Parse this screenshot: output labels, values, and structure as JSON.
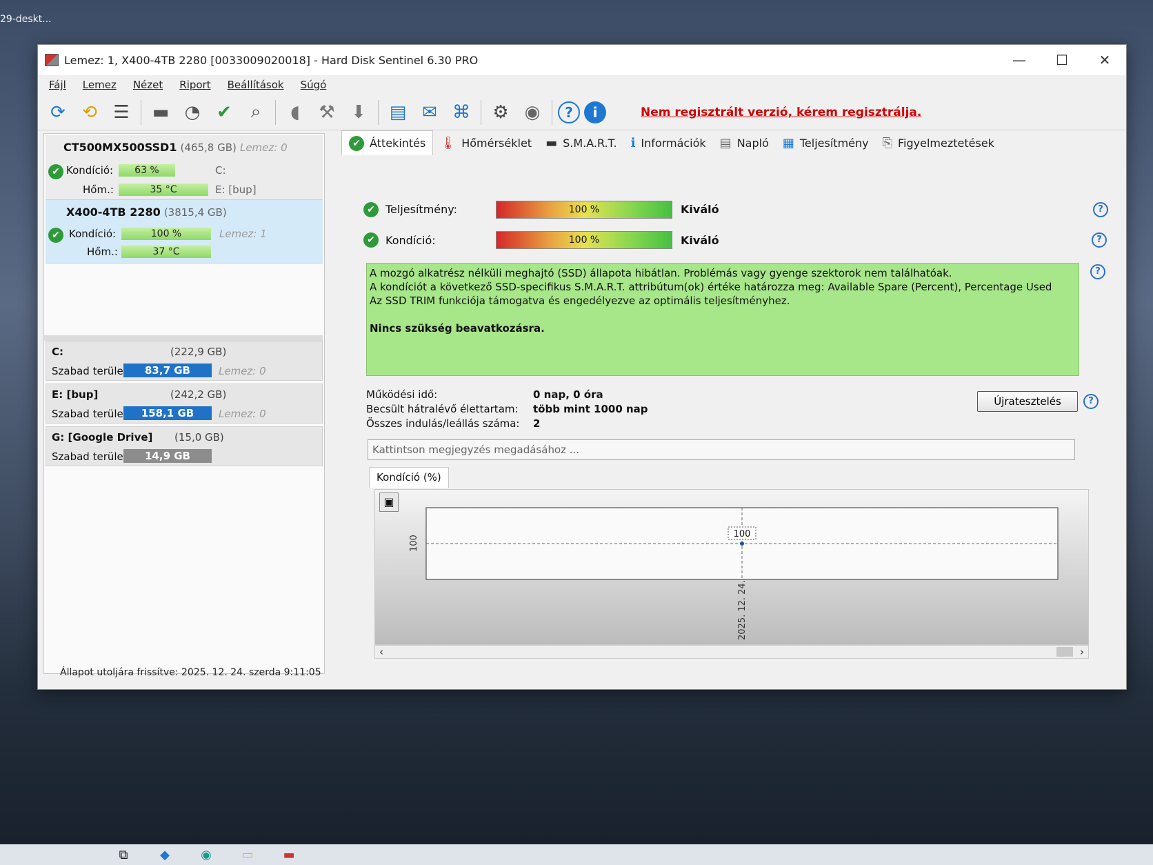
{
  "desktop": {
    "label": "29-deskt..."
  },
  "window": {
    "title": "Lemez: 1, X400-4TB 2280 [0033009020018]  -  Hard Disk Sentinel 6.30 PRO"
  },
  "controls": {
    "min": "—",
    "max": "☐",
    "close": "✕"
  },
  "menu": [
    "Fájl",
    "Lemez",
    "Nézet",
    "Riport",
    "Beállítások",
    "Súgó"
  ],
  "toolbar": {
    "icons": [
      "refresh-icon",
      "refresh-alert-icon",
      "disk-list-icon",
      "disk-icon",
      "disk-clock-icon",
      "disk-check-icon",
      "disk-search-icon",
      "helmet-icon",
      "disk-tools-icon",
      "disk-write-icon",
      "report-icon",
      "mail-icon",
      "network-icon",
      "settings-icon",
      "sound-icon",
      "help-icon",
      "info-icon"
    ],
    "glyphs": [
      "⟳",
      "⟲",
      "☰",
      "▬",
      "◔",
      "✔",
      "⌕",
      "◖",
      "⚒",
      "⬇",
      "▤",
      "✉",
      "⌘",
      "⚙",
      "◉",
      "?",
      "i"
    ],
    "registration": "Nem regisztrált verzió, kérem regisztrálja."
  },
  "disks": [
    {
      "name": "CT500MX500SSD1",
      "size": "(465,8 GB)",
      "lemez": "Lemez: 0",
      "condition_label": "Kondíció:",
      "condition": "63 %",
      "condition_value": 0.63,
      "temp_label": "Hőm.:",
      "temp": "35 °C",
      "vol1": "C:",
      "vol2": "E: [bup]"
    },
    {
      "name": "X400-4TB 2280",
      "size": "(3815,4 GB)",
      "lemez": "Lemez: 1",
      "condition_label": "Kondíció:",
      "condition": "100 %",
      "condition_value": 1.0,
      "temp_label": "Hőm.:",
      "temp": "37 °C"
    }
  ],
  "volumes": [
    {
      "name": "C:",
      "size": "(222,9 GB)",
      "free_label": "Szabad terület",
      "free": "83,7 GB",
      "lemez": "Lemez: 0"
    },
    {
      "name": "E: [bup]",
      "size": "(242,2 GB)",
      "free_label": "Szabad terület",
      "free": "158,1 GB",
      "lemez": "Lemez: 0"
    },
    {
      "name": "G: [Google Drive]",
      "size": "(15,0 GB)",
      "free_label": "Szabad terület",
      "free": "14,9 GB",
      "lemez": ""
    }
  ],
  "status": "Állapot utoljára frissítve: 2025. 12. 24. szerda 9:11:05",
  "tabs": [
    {
      "label": "Áttekintés",
      "icon": "check-icon",
      "glyph": "✔"
    },
    {
      "label": "Hőmérséklet",
      "icon": "thermometer-icon",
      "glyph": "🌡"
    },
    {
      "label": "S.M.A.R.T.",
      "icon": "smart-icon",
      "glyph": "▬"
    },
    {
      "label": "Információk",
      "icon": "info-icon",
      "glyph": "ℹ"
    },
    {
      "label": "Napló",
      "icon": "log-icon",
      "glyph": "▤"
    },
    {
      "label": "Teljesítmény",
      "icon": "performance-icon",
      "glyph": "▦"
    },
    {
      "label": "Figyelmeztetések",
      "icon": "warnings-icon",
      "glyph": "⎘"
    }
  ],
  "overview": {
    "performance": {
      "label": "Teljesítmény:",
      "value": "100 %",
      "status": "Kiváló"
    },
    "health": {
      "label": "Kondíció:",
      "value": "100 %",
      "status": "Kiváló"
    },
    "info_lines": [
      "A mozgó alkatrész nélküli meghajtó (SSD) állapota hibátlan. Problémás vagy gyenge szektorok nem találhatóak.",
      "A kondíciót a következő SSD-specifikus S.M.A.R.T. attribútum(ok) értéke határozza meg:  Available Spare (Percent), Percentage Used",
      "Az SSD TRIM funkciója támogatva és engedélyezve az optimális teljesítményhez."
    ],
    "conclusion": "Nincs szükség beavatkozásra.",
    "uptime_label": "Működési idő:",
    "uptime": "0 nap, 0 óra",
    "lifetime_label": "Becsült hátralévő élettartam:",
    "lifetime": "több mint 1000 nap",
    "starts_label": "Összes indulás/leállás száma:",
    "starts": "2",
    "retest": "Újratesztelés",
    "note_placeholder": "Kattintson megjegyzés megadásához ..."
  },
  "chart_tab": "Kondíció  (%)",
  "chart_data": {
    "type": "line",
    "x": [
      "2025. 12. 24."
    ],
    "series": [
      {
        "name": "Kondíció",
        "values": [
          100
        ]
      }
    ],
    "ylabel": "",
    "y_tick_labels": [
      "100"
    ],
    "data_labels": [
      "100"
    ]
  }
}
